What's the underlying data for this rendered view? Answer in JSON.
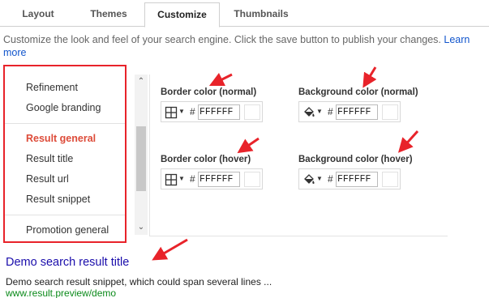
{
  "tabs": [
    {
      "label": "Layout",
      "active": false
    },
    {
      "label": "Themes",
      "active": false
    },
    {
      "label": "Customize",
      "active": true
    },
    {
      "label": "Thumbnails",
      "active": false
    }
  ],
  "description": {
    "text": "Customize the look and feel of your search engine. Click the save button to publish your changes. ",
    "link": "Learn more"
  },
  "sidebar": {
    "items": [
      {
        "label": "Refinement",
        "active": false
      },
      {
        "label": "Google branding",
        "active": false
      },
      {
        "label": "Result general",
        "active": true
      },
      {
        "label": "Result title",
        "active": false
      },
      {
        "label": "Result url",
        "active": false
      },
      {
        "label": "Result snippet",
        "active": false
      },
      {
        "label": "Promotion general",
        "active": false
      }
    ]
  },
  "color_groups": [
    {
      "label": "Border color (normal)",
      "icon": "border-grid-icon",
      "value": "FFFFFF"
    },
    {
      "label": "Background color (normal)",
      "icon": "paint-bucket-icon",
      "value": "FFFFFF"
    },
    {
      "label": "Border color (hover)",
      "icon": "border-grid-icon",
      "value": "FFFFFF"
    },
    {
      "label": "Background color (hover)",
      "icon": "paint-bucket-icon",
      "value": "FFFFFF"
    }
  ],
  "hash_symbol": "#",
  "preview": {
    "title": "Demo search result title",
    "snippet": "Demo search result snippet, which could span several lines ...",
    "url": "www.result.preview/demo"
  },
  "colors": {
    "annotation": "#e8232a",
    "active_item": "#dd4b39",
    "link": "#1a0dab",
    "url": "#0b8a1a"
  }
}
